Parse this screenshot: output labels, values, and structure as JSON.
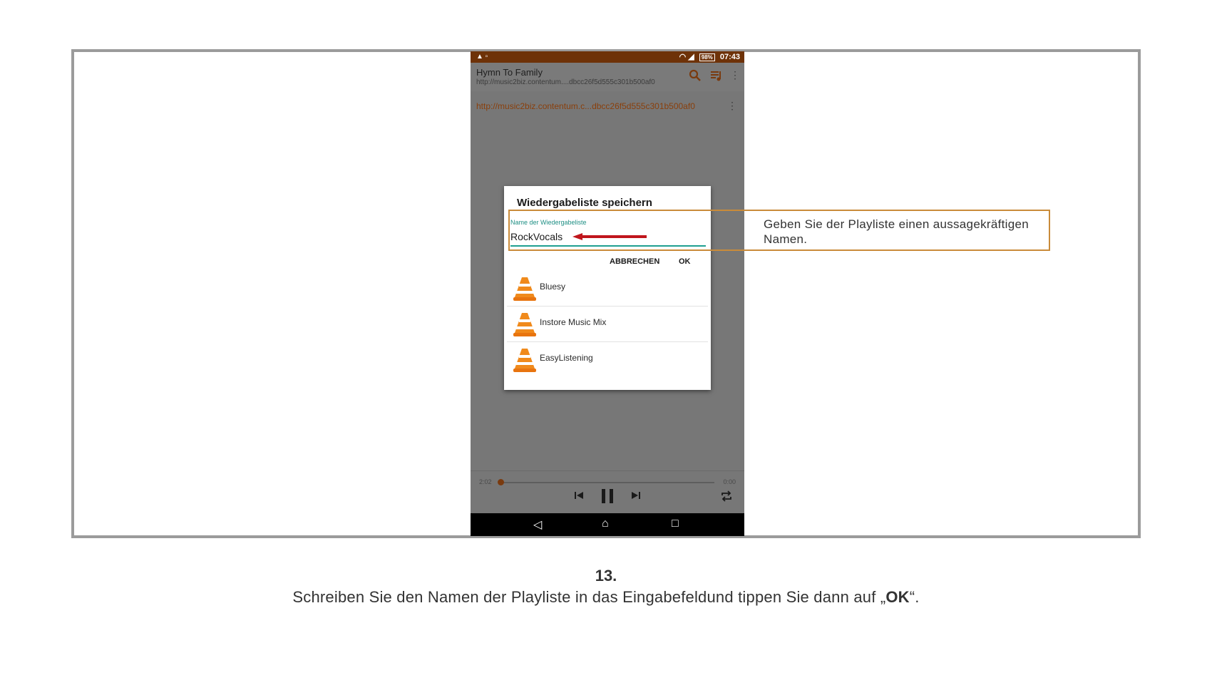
{
  "status_bar": {
    "time": "07:43",
    "battery": "98%"
  },
  "app_bar": {
    "title": "Hymn To Family",
    "subtitle": "http://music2biz.contentum....dbcc26f5d555c301b500af0"
  },
  "track_url": "http://music2biz.contentum.c...dbcc26f5d555c301b500af0",
  "dialog": {
    "title": "Wiedergabeliste speichern",
    "field_label": "Name der Wiedergabeliste",
    "field_value": "RockVocals",
    "cancel_label": "ABBRECHEN",
    "ok_label": "OK",
    "playlists": [
      {
        "name": "Bluesy"
      },
      {
        "name": "Instore Music Mix"
      },
      {
        "name": "EasyListening"
      }
    ]
  },
  "player": {
    "elapsed": "2:02",
    "duration": "0:00",
    "progress": 0.0
  },
  "callout": {
    "text": "Geben Sie der Playliste einen aussagekräftigen Namen."
  },
  "caption": {
    "step": "13.",
    "text_before": "Schreiben Sie den Namen der Playliste in das Eingabefeldund tippen Sie dann auf „",
    "text_bold": "OK",
    "text_after": "“."
  },
  "colors": {
    "accent": "#e8740f",
    "teal": "#1e9f90",
    "status_bar": "#6e3208",
    "callout_border": "#c98b3a"
  }
}
